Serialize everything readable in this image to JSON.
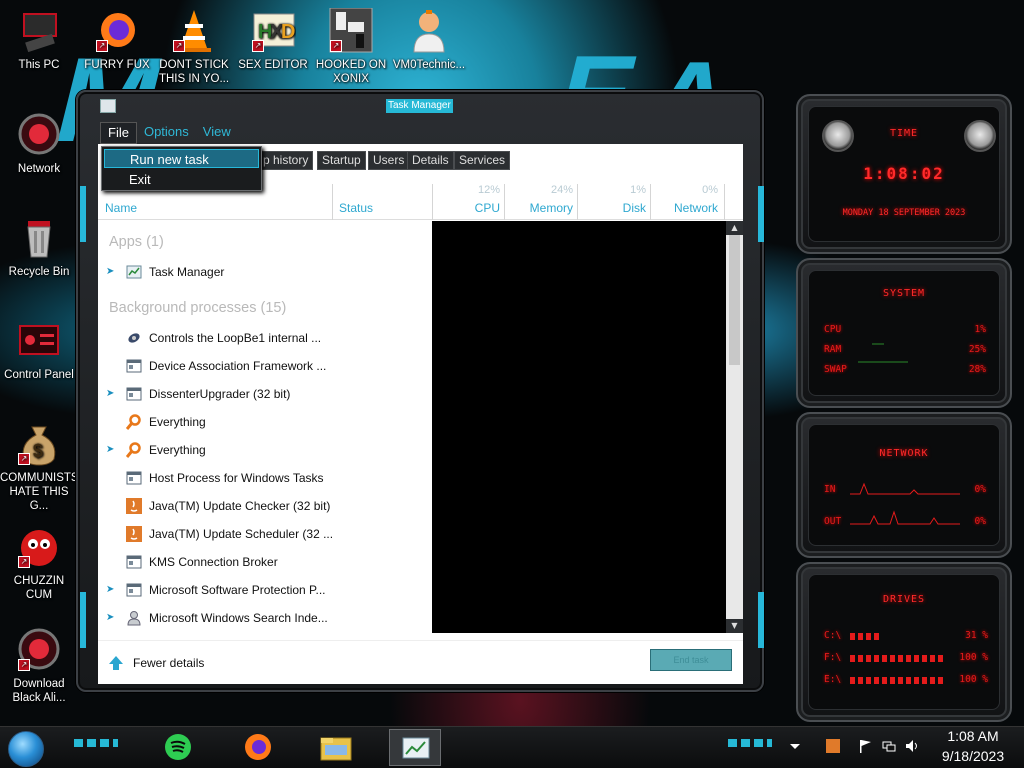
{
  "desktop": {
    "icons": [
      {
        "label": "This PC"
      },
      {
        "label": "FURRY FUX"
      },
      {
        "label": "DONT STICK THIS IN YO..."
      },
      {
        "label": "SEX EDITOR"
      },
      {
        "label": "HOOKED ON XONIX"
      },
      {
        "label": "VM0Technic..."
      },
      {
        "label": "Network"
      },
      {
        "label": "Recycle Bin"
      },
      {
        "label": "Control Panel"
      },
      {
        "label": "COMMUNISTS HATE THIS G..."
      },
      {
        "label": "CHUZZIN CUM"
      },
      {
        "label": "Download Black Ali..."
      }
    ],
    "wallpaper_text": "MR REACT"
  },
  "task_manager": {
    "title": "Task Manager",
    "menu": {
      "file": "File",
      "options": "Options",
      "view": "View"
    },
    "file_menu": {
      "run_new_task": "Run new task",
      "exit": "Exit"
    },
    "tabs": [
      "p history",
      "Startup",
      "Users",
      "Details",
      "Services"
    ],
    "columns": {
      "name": "Name",
      "status": "Status",
      "cpu": {
        "label": "CPU",
        "pct": "12%"
      },
      "memory": {
        "label": "Memory",
        "pct": "24%"
      },
      "disk": {
        "label": "Disk",
        "pct": "1%"
      },
      "network": {
        "label": "Network",
        "pct": "0%"
      }
    },
    "groups": {
      "apps": "Apps (1)",
      "background": "Background processes (15)"
    },
    "apps": [
      {
        "name": "Task Manager",
        "expandable": true
      }
    ],
    "background": [
      {
        "name": "Controls the LoopBe1 internal ...",
        "expandable": false,
        "icon": "speaker-icon"
      },
      {
        "name": "Device Association Framework ...",
        "expandable": false,
        "icon": "window-icon"
      },
      {
        "name": "DissenterUpgrader (32 bit)",
        "expandable": true,
        "icon": "window-icon"
      },
      {
        "name": "Everything",
        "expandable": false,
        "icon": "magnifier-icon"
      },
      {
        "name": "Everything",
        "expandable": true,
        "icon": "magnifier-icon"
      },
      {
        "name": "Host Process for Windows Tasks",
        "expandable": false,
        "icon": "window-icon"
      },
      {
        "name": "Java(TM) Update Checker (32 bit)",
        "expandable": false,
        "icon": "java-icon"
      },
      {
        "name": "Java(TM) Update Scheduler (32 ...",
        "expandable": false,
        "icon": "java-icon"
      },
      {
        "name": "KMS Connection Broker",
        "expandable": false,
        "icon": "window-icon"
      },
      {
        "name": "Microsoft Software Protection P...",
        "expandable": true,
        "icon": "window-icon"
      },
      {
        "name": "Microsoft Windows Search Inde...",
        "expandable": true,
        "icon": "user-icon"
      }
    ],
    "footer": {
      "fewer_details": "Fewer details",
      "end_task": "End task"
    }
  },
  "gadgets": {
    "time": {
      "title": "TIME",
      "clock": "1:08:02",
      "date": "MONDAY 18 SEPTEMBER 2023"
    },
    "system": {
      "title": "SYSTEM",
      "cpu_label": "CPU",
      "cpu": "1%",
      "ram_label": "RAM",
      "ram": "25%",
      "swap_label": "SWAP",
      "swap": "28%"
    },
    "network": {
      "title": "NETWORK",
      "in_label": "IN",
      "in": "0%",
      "out_label": "OUT",
      "out": "0%"
    },
    "drives": {
      "title": "DRIVES",
      "items": [
        {
          "label": "C:\\",
          "value": "31 %",
          "fill": 0.31
        },
        {
          "label": "F:\\",
          "value": "100 %",
          "fill": 1.0
        },
        {
          "label": "E:\\",
          "value": "100 %",
          "fill": 1.0
        }
      ]
    }
  },
  "taskbar": {
    "time": "1:08 AM",
    "date": "9/18/2023"
  }
}
